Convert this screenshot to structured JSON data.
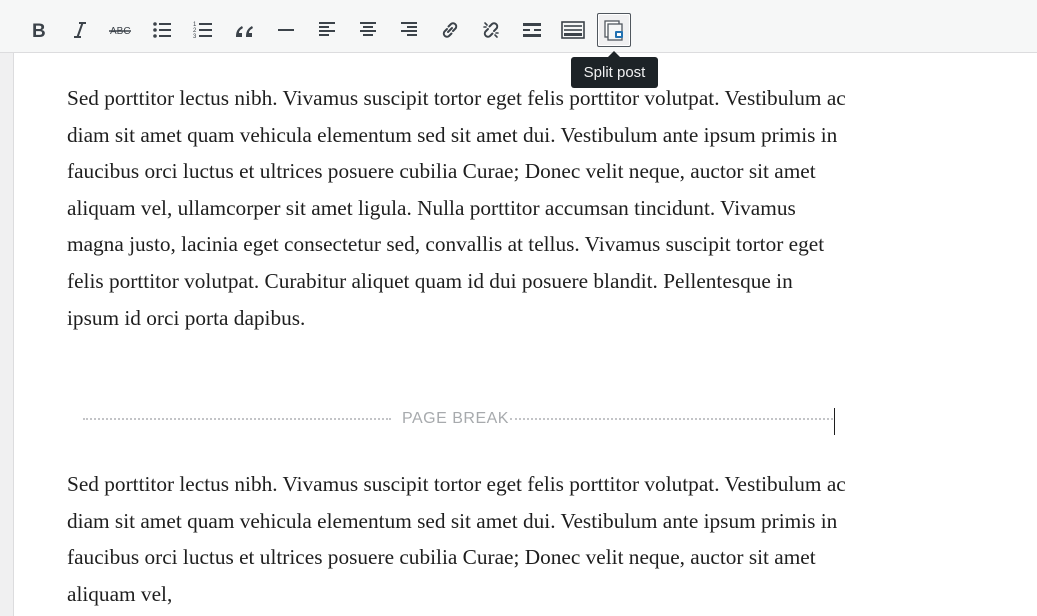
{
  "toolbar": {
    "buttons": [
      {
        "id": "bold",
        "icon": "bold-icon"
      },
      {
        "id": "italic",
        "icon": "italic-icon"
      },
      {
        "id": "strikethrough",
        "icon": "strikethrough-icon",
        "glyph_text": "ABC"
      },
      {
        "id": "bulleted-list",
        "icon": "bulleted-list-icon"
      },
      {
        "id": "numbered-list",
        "icon": "numbered-list-icon"
      },
      {
        "id": "blockquote",
        "icon": "blockquote-icon"
      },
      {
        "id": "horizontal-line",
        "icon": "horizontal-line-icon"
      },
      {
        "id": "align-left",
        "icon": "align-left-icon"
      },
      {
        "id": "align-center",
        "icon": "align-center-icon"
      },
      {
        "id": "align-right",
        "icon": "align-right-icon"
      },
      {
        "id": "insert-link",
        "icon": "link-icon"
      },
      {
        "id": "remove-link",
        "icon": "unlink-icon"
      },
      {
        "id": "read-more",
        "icon": "read-more-icon"
      },
      {
        "id": "toolbar-toggle",
        "icon": "keyboard-icon"
      },
      {
        "id": "split-post",
        "icon": "split-post-icon",
        "active": true
      }
    ],
    "tooltip": "Split post"
  },
  "content": {
    "paragraph1": "Sed porttitor lectus nibh. Vivamus suscipit tortor eget felis porttitor volutpat. Vestibulum ac diam sit amet quam vehicula elementum sed sit amet dui. Vestibulum ante ipsum primis in faucibus orci luctus et ultrices posuere cubilia Curae; Donec velit neque, auctor sit amet aliquam vel, ullamcorper sit amet ligula. Nulla porttitor accumsan tincidunt. Vivamus magna justo, lacinia eget consectetur sed, convallis at tellus. Vivamus suscipit tortor eget felis porttitor volutpat. Curabitur aliquet quam id dui posuere blandit. Pellentesque in ipsum id orci porta dapibus.",
    "page_break_label": "PAGE BREAK",
    "paragraph2": "Sed porttitor lectus nibh. Vivamus suscipit tortor eget felis porttitor volutpat. Vestibulum ac diam sit amet quam vehicula elementum sed sit amet dui. Vestibulum ante ipsum primis in faucibus orci luctus et ultrices posuere cubilia Curae; Donec velit neque, auctor sit amet aliquam vel,"
  },
  "colors": {
    "icon": "#3c434a",
    "toolbar_bg": "#f6f7f7",
    "tooltip_bg": "#1d2327",
    "split_post_accent": "#2271b1"
  }
}
